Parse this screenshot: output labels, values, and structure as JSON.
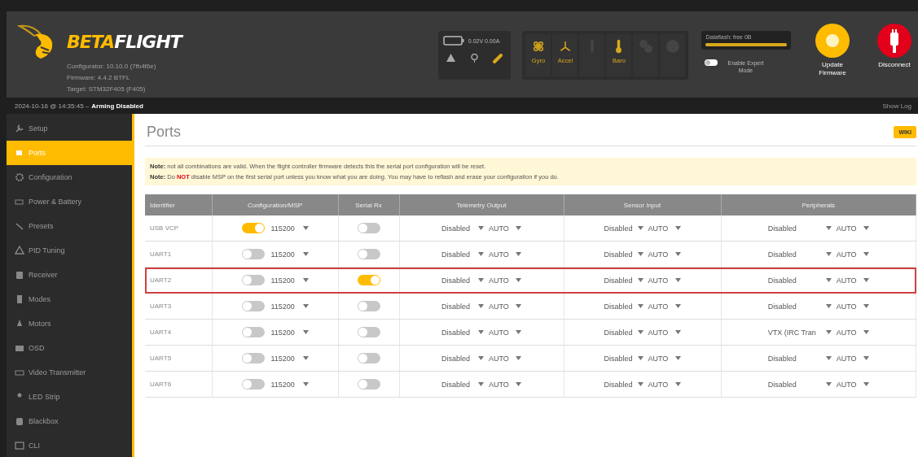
{
  "header": {
    "logo": {
      "part_1": "BETA",
      "part_2": "FLIGHT"
    },
    "info": [
      "Configurator: 10.10.0 (7fb4f6e)",
      "Firmware: 4.4.2 BTFL",
      "Target: STM32F405 (F405)"
    ],
    "battery": "0.02V 0.00A",
    "sensors": [
      {
        "label": "Gyro",
        "active": true
      },
      {
        "label": "Accel",
        "active": true
      },
      {
        "active": false
      },
      {
        "label": "Baro",
        "active": true
      },
      {
        "active": false
      },
      {
        "active": false
      }
    ],
    "dataflash": {
      "label": "Dataflash: free 0B",
      "level": 1
    },
    "expert_mode": {
      "label": "Enable Expert Mode",
      "on": false
    },
    "buttons": [
      {
        "kind": "update",
        "label": "Update Firmware"
      },
      {
        "kind": "disconnect",
        "label": "Disconnect"
      }
    ]
  },
  "status_bar": {
    "time": "2024-10-16 @ 14:35:45 –",
    "state": "Arming Disabled",
    "log": "Show Log"
  },
  "sidebar": {
    "items": [
      {
        "label": "Setup",
        "selected": false
      },
      {
        "label": "Ports",
        "selected": true
      },
      {
        "label": "Configuration",
        "selected": false
      },
      {
        "label": "Power & Battery",
        "selected": false
      },
      {
        "label": "Presets",
        "selected": false
      },
      {
        "label": "PID Tuning",
        "selected": false
      },
      {
        "label": "Receiver",
        "selected": false
      },
      {
        "label": "Modes",
        "selected": false
      },
      {
        "label": "Motors",
        "selected": false
      },
      {
        "label": "OSD",
        "selected": false
      },
      {
        "label": "Video Transmitter",
        "selected": false
      },
      {
        "label": "LED Strip",
        "selected": false
      },
      {
        "label": "Blackbox",
        "selected": false
      },
      {
        "label": "CLI",
        "selected": false
      }
    ]
  },
  "page": {
    "title": "Ports",
    "wiki": "WIKI",
    "notes": [
      [
        {
          "text": "Note:",
          "kind": "label"
        },
        {
          "text": " not all combinations are valid. When the flight controller firmware detects this the serial port configuration will be reset.",
          "kind": "plain"
        }
      ],
      [
        {
          "text": "Note:",
          "kind": "label"
        },
        {
          "text": " Do ",
          "kind": "plain"
        },
        {
          "text": "NOT",
          "kind": "warning"
        },
        {
          "text": " disable MSP on the first serial port unless you know what you are doing. You may have to reflash and erase your configuration if you do.",
          "kind": "plain"
        }
      ]
    ],
    "table": {
      "columns": [
        "Identifier",
        "Configuration/MSP",
        "Serial Rx",
        "Telemetry Output",
        "Sensor Input",
        "Peripherals"
      ],
      "rows": [
        {
          "identifier": "USB VCP",
          "msp": true,
          "baud": "115200",
          "serial_rx": false,
          "telemetry": [
            "Disabled",
            "AUTO"
          ],
          "sensor": [
            "Disabled",
            "AUTO"
          ],
          "peripherals": [
            "Disabled",
            "AUTO"
          ],
          "highlighted": false
        },
        {
          "identifier": "UART1",
          "msp": false,
          "baud": "115200",
          "serial_rx": false,
          "telemetry": [
            "Disabled",
            "AUTO"
          ],
          "sensor": [
            "Disabled",
            "AUTO"
          ],
          "peripherals": [
            "Disabled",
            "AUTO"
          ],
          "highlighted": false
        },
        {
          "identifier": "UART2",
          "msp": false,
          "baud": "115200",
          "serial_rx": true,
          "telemetry": [
            "Disabled",
            "AUTO"
          ],
          "sensor": [
            "Disabled",
            "AUTO"
          ],
          "peripherals": [
            "Disabled",
            "AUTO"
          ],
          "highlighted": true
        },
        {
          "identifier": "UART3",
          "msp": false,
          "baud": "115200",
          "serial_rx": false,
          "telemetry": [
            "Disabled",
            "AUTO"
          ],
          "sensor": [
            "Disabled",
            "AUTO"
          ],
          "peripherals": [
            "Disabled",
            "AUTO"
          ],
          "highlighted": false
        },
        {
          "identifier": "UART4",
          "msp": false,
          "baud": "115200",
          "serial_rx": false,
          "telemetry": [
            "Disabled",
            "AUTO"
          ],
          "sensor": [
            "Disabled",
            "AUTO"
          ],
          "peripherals": [
            "VTX (IRC Tran",
            "AUTO"
          ],
          "highlighted": false
        },
        {
          "identifier": "UART5",
          "msp": false,
          "baud": "115200",
          "serial_rx": false,
          "telemetry": [
            "Disabled",
            "AUTO"
          ],
          "sensor": [
            "Disabled",
            "AUTO"
          ],
          "peripherals": [
            "Disabled",
            "AUTO"
          ],
          "highlighted": false
        },
        {
          "identifier": "UART6",
          "msp": false,
          "baud": "115200",
          "serial_rx": false,
          "telemetry": [
            "Disabled",
            "AUTO"
          ],
          "sensor": [
            "Disabled",
            "AUTO"
          ],
          "peripherals": [
            "Disabled",
            "AUTO"
          ],
          "highlighted": false
        }
      ]
    }
  }
}
